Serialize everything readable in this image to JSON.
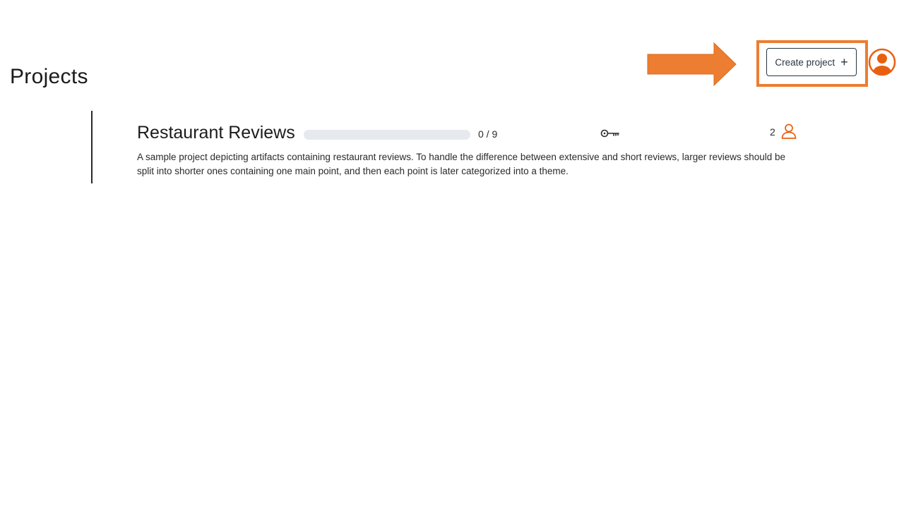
{
  "header": {
    "title": "Projects",
    "create_button_label": "Create project",
    "create_button_icon": "plus-icon",
    "avatar_icon": "user-circle-icon",
    "accent_color": "#ed7d31"
  },
  "annotation": {
    "arrow_color": "#ed7d31",
    "highlight_color": "#ed7d31"
  },
  "projects": [
    {
      "name": "Restaurant Reviews",
      "progress_text": "0 / 9",
      "progress_fraction": 0,
      "key_icon": "key-icon",
      "member_count": "2",
      "member_icon": "user-icon",
      "description": "A sample project depicting artifacts containing restaurant reviews. To handle the difference between extensive and short reviews, larger reviews should be split into shorter ones containing one main point, and then each point is later categorized into a theme."
    }
  ]
}
